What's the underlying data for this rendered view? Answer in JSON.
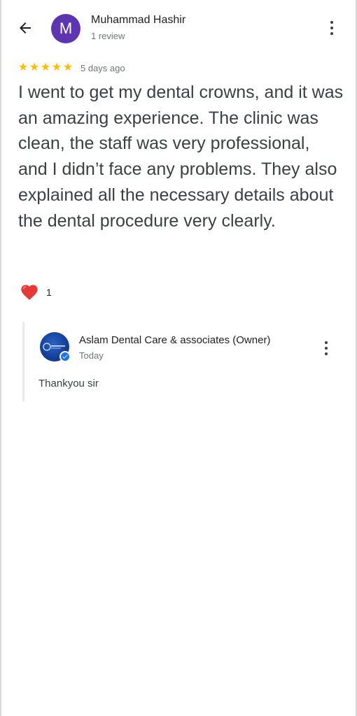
{
  "header": {
    "back_icon": "arrow-left-icon",
    "avatar_initial": "M",
    "avatar_color": "#5e35b1",
    "reviewer_name": "Muhammad Hashir",
    "reviewer_meta": "1 review",
    "more_icon": "more-vertical-icon"
  },
  "review": {
    "rating": 5,
    "stars": [
      "★",
      "★",
      "★",
      "★",
      "★"
    ],
    "star_color": "#fbbc04",
    "date": "5 days ago",
    "text": "I went to get my dental crowns, and it was an amazing experience. The clinic was clean, the staff was very professional, and I didn’t face any problems. They also explained all the necessary details about the dental procedure very clearly."
  },
  "reactions": {
    "icon": "heart-icon",
    "count": "1"
  },
  "owner_reply": {
    "name": "Aslam Dental Care & associates (Owner)",
    "date": "Today",
    "text": "Thankyou sir",
    "verified_icon": "verified-check-icon",
    "more_icon": "more-vertical-icon",
    "accent": "#1a73e8"
  }
}
